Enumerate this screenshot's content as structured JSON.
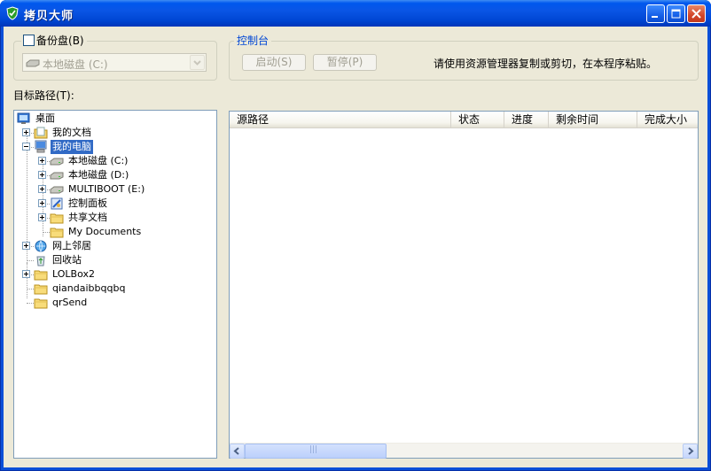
{
  "window": {
    "title": "拷贝大师"
  },
  "backup": {
    "checkbox_label": "备份盘",
    "checkbox_hotkey": "(B)",
    "checked": false,
    "drive_selected": "本地磁盘 (C:)"
  },
  "control": {
    "title": "控制台",
    "start_label": "启动(S)",
    "pause_label": "暂停(P)",
    "hint": "请使用资源管理器复制或剪切，在本程序粘贴。"
  },
  "target_path_label": "目标路径(T):",
  "tree": [
    {
      "label": "桌面",
      "icon": "desktop-icon",
      "selected": false
    },
    {
      "label": "我的文档",
      "icon": "my-documents-icon",
      "selected": false
    },
    {
      "label": "我的电脑",
      "icon": "my-computer-icon",
      "selected": true
    },
    {
      "label": "本地磁盘 (C:)",
      "icon": "drive-icon",
      "selected": false
    },
    {
      "label": "本地磁盘 (D:)",
      "icon": "drive-icon",
      "selected": false
    },
    {
      "label": "MULTIBOOT (E:)",
      "icon": "drive-icon",
      "selected": false
    },
    {
      "label": "控制面板",
      "icon": "control-panel-icon",
      "selected": false
    },
    {
      "label": "共享文档",
      "icon": "folder-icon",
      "selected": false
    },
    {
      "label": "My Documents",
      "icon": "folder-icon",
      "selected": false
    },
    {
      "label": "网上邻居",
      "icon": "network-icon",
      "selected": false
    },
    {
      "label": "回收站",
      "icon": "recycle-bin-icon",
      "selected": false
    },
    {
      "label": "LOLBox2",
      "icon": "folder-icon",
      "selected": false
    },
    {
      "label": "qiandaibbqqbq",
      "icon": "folder-icon",
      "selected": false
    },
    {
      "label": "qrSend",
      "icon": "folder-icon",
      "selected": false
    }
  ],
  "list": {
    "columns": [
      "源路径",
      "状态",
      "进度",
      "剩余时间",
      "完成大小"
    ],
    "rows": []
  },
  "scrollbar_grip": "|||",
  "colors": {
    "titlebar": "#0058ee",
    "client": "#ece9d8",
    "selection": "#316ac5",
    "group_title": "#0046d5"
  }
}
